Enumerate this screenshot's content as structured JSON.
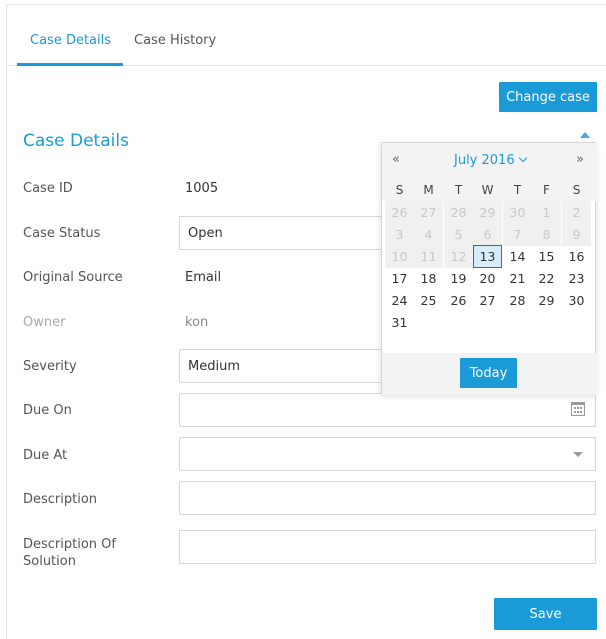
{
  "tabs": [
    {
      "label": "Case Details",
      "active": true
    },
    {
      "label": "Case History",
      "active": false
    }
  ],
  "change_case_button": "Change case",
  "section_title": "Case Details",
  "fields": {
    "case_id": {
      "label": "Case ID",
      "value": "1005"
    },
    "case_status": {
      "label": "Case Status",
      "value": "Open"
    },
    "original_source": {
      "label": "Original Source",
      "value": "Email"
    },
    "owner": {
      "label": "Owner",
      "value": "kon"
    },
    "severity": {
      "label": "Severity",
      "value": "Medium"
    },
    "due_on": {
      "label": "Due On",
      "value": ""
    },
    "due_at": {
      "label": "Due At",
      "value": ""
    },
    "description": {
      "label": "Description",
      "value": ""
    },
    "description_of_solution": {
      "label": "Description Of Solution",
      "value": ""
    }
  },
  "datepicker": {
    "prev": "«",
    "next": "»",
    "title": "July 2016",
    "weekdays": [
      "S",
      "M",
      "T",
      "W",
      "T",
      "F",
      "S"
    ],
    "days": [
      {
        "n": "26",
        "out": true
      },
      {
        "n": "27",
        "out": true
      },
      {
        "n": "28",
        "out": true
      },
      {
        "n": "29",
        "out": true
      },
      {
        "n": "30",
        "out": true
      },
      {
        "n": "1",
        "out": true
      },
      {
        "n": "2",
        "out": true
      },
      {
        "n": "3",
        "out": true
      },
      {
        "n": "4",
        "out": true
      },
      {
        "n": "5",
        "out": true
      },
      {
        "n": "6",
        "out": true
      },
      {
        "n": "7",
        "out": true
      },
      {
        "n": "8",
        "out": true
      },
      {
        "n": "9",
        "out": true
      },
      {
        "n": "10",
        "out": true
      },
      {
        "n": "11",
        "out": true
      },
      {
        "n": "12",
        "out": true
      },
      {
        "n": "13",
        "out": false,
        "selected": true
      },
      {
        "n": "14",
        "out": false
      },
      {
        "n": "15",
        "out": false
      },
      {
        "n": "16",
        "out": false
      },
      {
        "n": "17",
        "out": false
      },
      {
        "n": "18",
        "out": false
      },
      {
        "n": "19",
        "out": false
      },
      {
        "n": "20",
        "out": false
      },
      {
        "n": "21",
        "out": false
      },
      {
        "n": "22",
        "out": false
      },
      {
        "n": "23",
        "out": false
      },
      {
        "n": "24",
        "out": false
      },
      {
        "n": "25",
        "out": false
      },
      {
        "n": "26",
        "out": false
      },
      {
        "n": "27",
        "out": false
      },
      {
        "n": "28",
        "out": false
      },
      {
        "n": "29",
        "out": false
      },
      {
        "n": "30",
        "out": false
      },
      {
        "n": "31",
        "out": false
      }
    ],
    "today_label": "Today"
  },
  "save_button": "Save",
  "colors": {
    "accent": "#1a9bd7",
    "selected_day_border": "#b04040"
  },
  "icons": {
    "due_on": "calendar-icon",
    "due_at": "caret-down-icon"
  }
}
